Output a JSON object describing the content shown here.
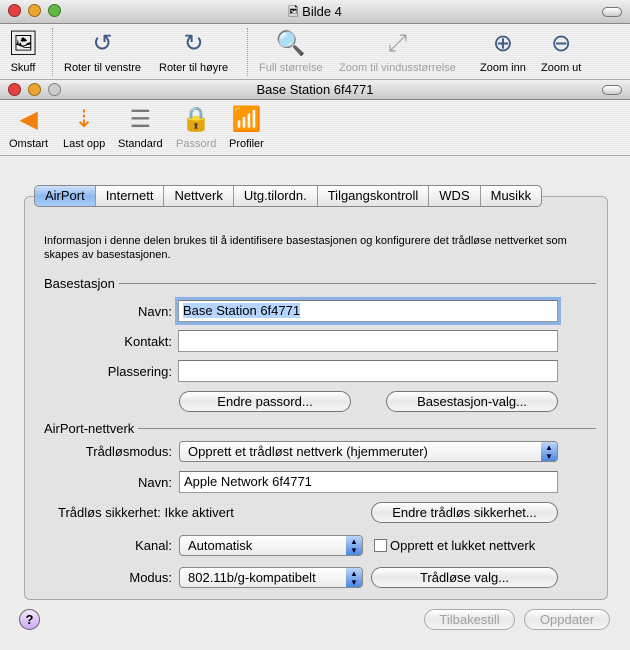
{
  "viewer": {
    "title": "Bilde 4",
    "toolbar": [
      {
        "label": "Skuff",
        "icon": "photo-drawer-icon"
      },
      {
        "label": "Roter til venstre",
        "icon": "rotate-left-icon"
      },
      {
        "label": "Roter til høyre",
        "icon": "rotate-right-icon"
      },
      {
        "label": "Full størrelse",
        "icon": "actual-size-icon"
      },
      {
        "label": "Zoom til vindusstørrelse",
        "icon": "zoom-to-fit-icon"
      },
      {
        "label": "Zoom inn",
        "icon": "zoom-in-icon"
      },
      {
        "label": "Zoom ut",
        "icon": "zoom-out-icon"
      }
    ]
  },
  "utility": {
    "title": "Base Station 6f4771",
    "toolbar": [
      {
        "label": "Omstart",
        "icon": "restart-icon"
      },
      {
        "label": "Last opp",
        "icon": "upload-icon"
      },
      {
        "label": "Standard",
        "icon": "default-icon"
      },
      {
        "label": "Passord",
        "icon": "lock-icon"
      },
      {
        "label": "Profiler",
        "icon": "profiles-icon"
      }
    ]
  },
  "tabs": [
    "AirPort",
    "Internett",
    "Nettverk",
    "Utg.tilordn.",
    "Tilgangskontroll",
    "WDS",
    "Musikk"
  ],
  "description": "Informasjon i denne delen brukes til å identifisere basestasjonen og konfigurere det trådløse nettverket som skapes av basestasjonen.",
  "base": {
    "heading": "Basestasjon",
    "name_label": "Navn:",
    "name_value": "Base Station 6f4771",
    "contact_label": "Kontakt:",
    "contact_value": "",
    "location_label": "Plassering:",
    "location_value": "",
    "change_password": "Endre passord...",
    "base_options": "Basestasjon-valg..."
  },
  "network": {
    "heading": "AirPort-nettverk",
    "mode_label": "Trådløsmodus:",
    "mode_value": "Opprett et trådløst nettverk (hjemmeruter)",
    "name_label": "Navn:",
    "name_value": "Apple Network 6f4771",
    "security_label": "Trådløs sikkerhet:",
    "security_value": "Ikke aktivert",
    "change_security": "Endre trådløs sikkerhet...",
    "channel_label": "Kanal:",
    "channel_value": "Automatisk",
    "closed_network": "Opprett et lukket nettverk",
    "closed_checked": false,
    "radio_label": "Modus:",
    "radio_value": "802.11b/g-kompatibelt",
    "wireless_options": "Trådløse valg..."
  },
  "footer": {
    "help": "?",
    "revert": "Tilbakestill",
    "update": "Oppdater"
  }
}
